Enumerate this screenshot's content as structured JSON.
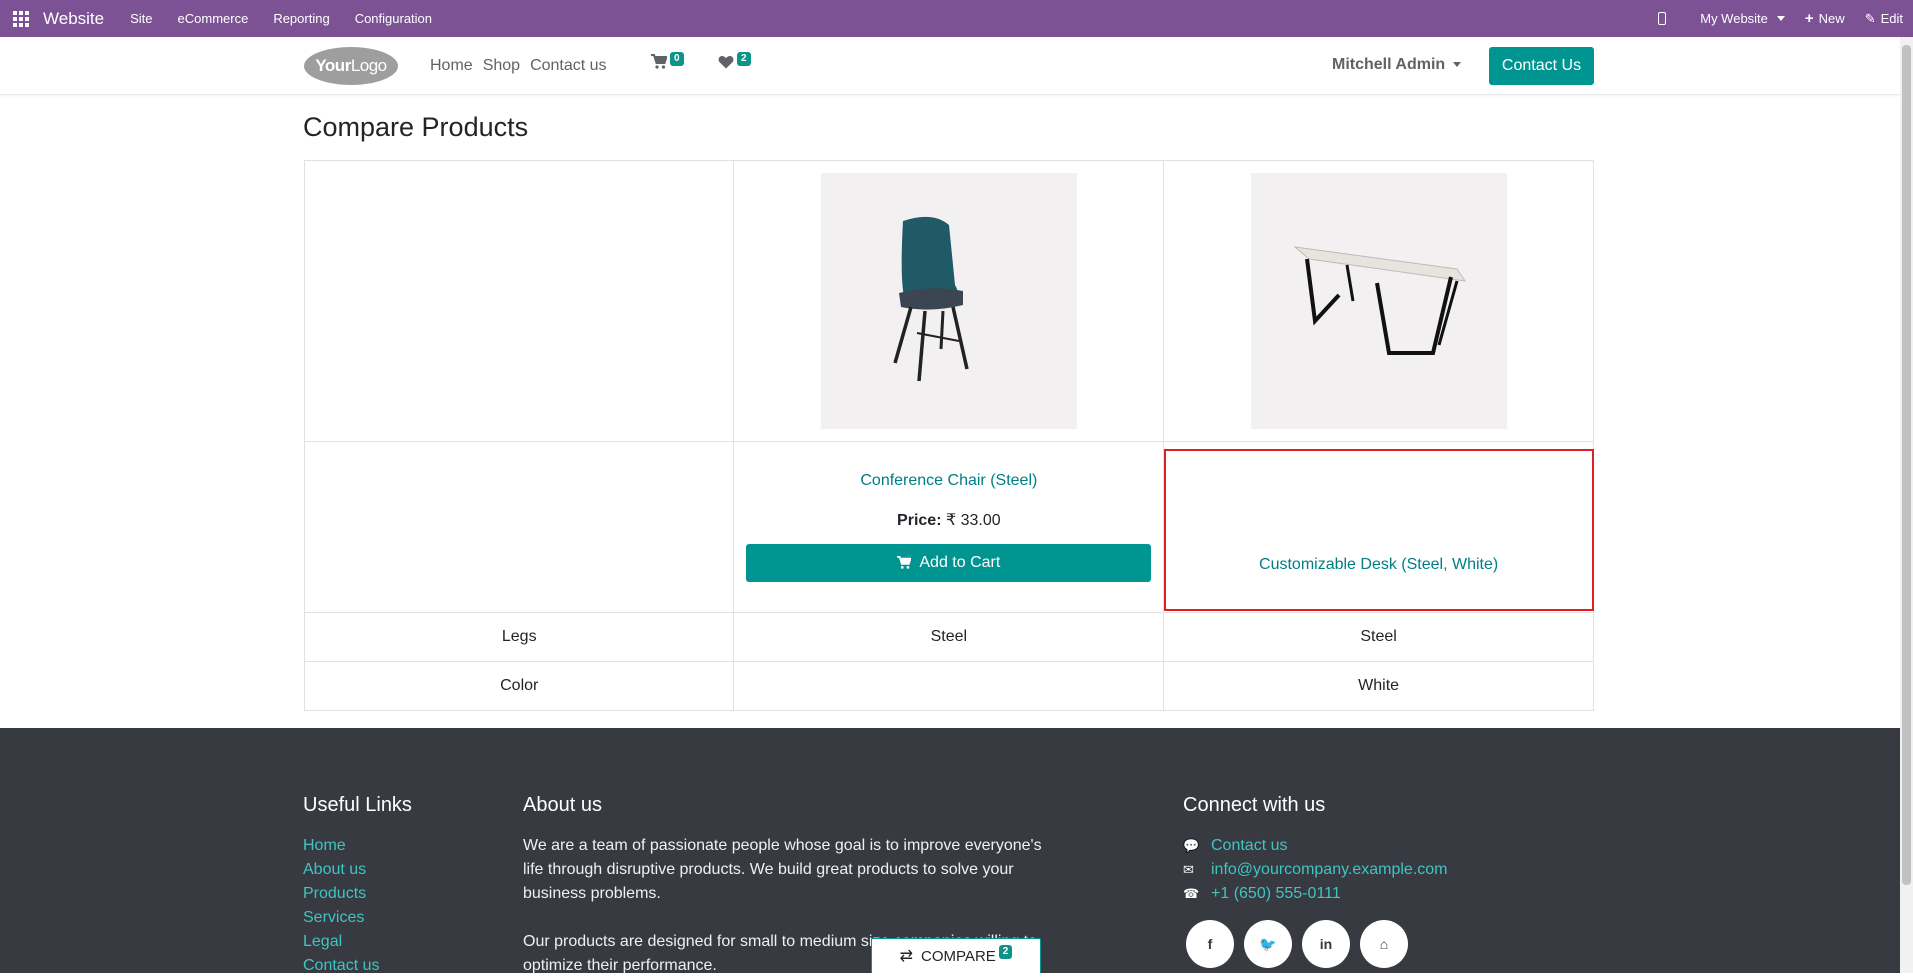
{
  "adminbar": {
    "brand": "Website",
    "menu": [
      "Site",
      "eCommerce",
      "Reporting",
      "Configuration"
    ],
    "website_selector": "My Website",
    "new_label": "New",
    "edit_label": "Edit"
  },
  "header": {
    "logo_bold": "Your",
    "logo_rest": "Logo",
    "nav": [
      "Home",
      "Shop",
      "Contact us"
    ],
    "cart_count": "0",
    "wishlist_count": "2",
    "user": "Mitchell Admin",
    "contact_button": "Contact Us"
  },
  "main": {
    "title": "Compare Products",
    "products": [
      {
        "name": "Conference Chair (Steel)",
        "price_label": "Price:",
        "price": "₹ 33.00",
        "add_to_cart": "Add to Cart"
      },
      {
        "name": "Customizable Desk (Steel, White)"
      }
    ],
    "attributes": [
      {
        "name": "Legs",
        "values": [
          "Steel",
          "Steel"
        ]
      },
      {
        "name": "Color",
        "values": [
          "",
          "White"
        ]
      }
    ]
  },
  "footer": {
    "useful_links_title": "Useful Links",
    "useful_links": [
      "Home",
      "About us",
      "Products",
      "Services",
      "Legal",
      "Contact us"
    ],
    "about_title": "About us",
    "about_p1": "We are a team of passionate people whose goal is to improve everyone's life through disruptive products. We build great products to solve your business problems.",
    "about_p2": "Our products are designed for small to medium size companies willing to optimize their performance.",
    "connect_title": "Connect with us",
    "contact_link": "Contact us",
    "email": "info@yourcompany.example.com",
    "phone": "+1 (650) 555-0111",
    "socials": [
      "facebook-icon",
      "twitter-icon",
      "linkedin-icon",
      "home-icon"
    ]
  },
  "compare_pill": {
    "label": "COMPARE",
    "count": "2"
  },
  "colors": {
    "admin_bar": "#7c5295",
    "primary": "#019592",
    "link": "#017e84",
    "footer_bg": "#373a41",
    "highlight": "#e02020"
  }
}
